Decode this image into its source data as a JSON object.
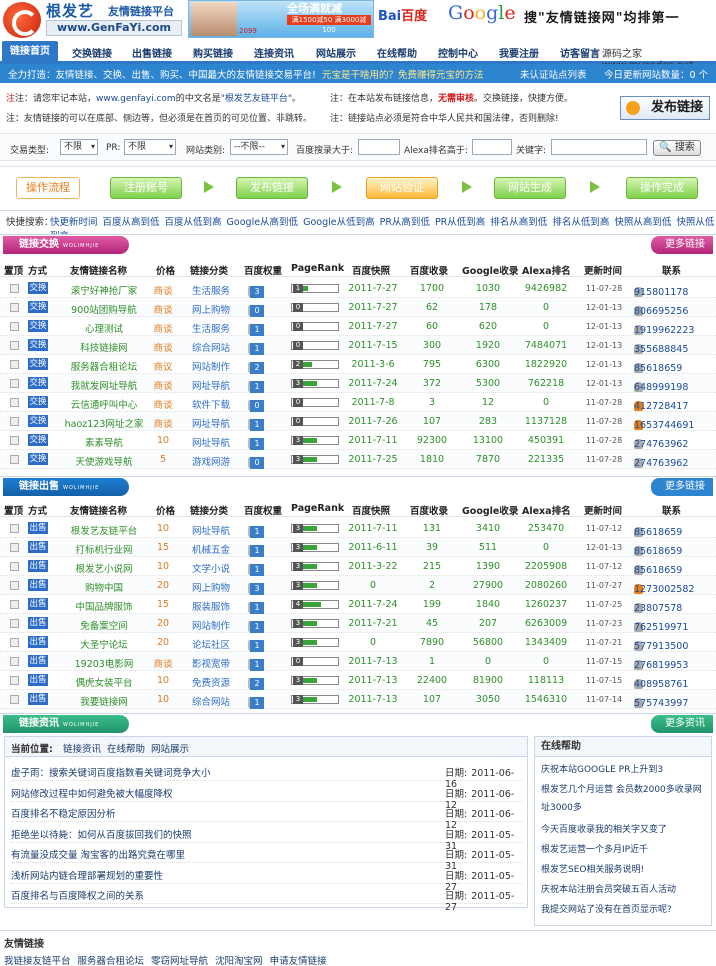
{
  "header": {
    "logo_text": "根发艺",
    "logo_sub": "友情链接平台",
    "logo_url": "www.GenFaYi.com",
    "ad_title": "全场满就减",
    "ad_line": "满1500减50  满3000减100",
    "ad_line2": "2099",
    "baidu": "Bai",
    "baidu_cn": "百度",
    "google": "Google",
    "slogan": "搜\"友情链接网\"均排第一"
  },
  "nav": {
    "items": [
      "链接首页",
      "交换链接",
      "出售链接",
      "购买链接",
      "连接资讯",
      "网站展示",
      "在线帮助",
      "控制中心",
      "我要注册",
      "访客留言"
    ],
    "right": "源码之家www.mycodes.net"
  },
  "subbar": {
    "left": "全力打造：友情链接、交换、出售、购买、中国最大的友情链接交易平台!",
    "highlight": "元宝是干啥用的？免费赚得元宝的方法",
    "middle": "未认证站点列表",
    "right": "今日更新网站数量：0 个"
  },
  "notice": {
    "l1_pre": "注：请您牢记本站，",
    "l1_url": "www.genfayi.com",
    "l1_mid": "的中文名是",
    "l1_name": "\"根发艺友链平台\"",
    "l1_end": "。",
    "l2": "注：友情链接的可以在底部、侧边等，但必须是在首页的可见位置、非跳转。",
    "r1_pre": "注：在本站发布链接信息，",
    "r1_red": "无需审核",
    "r1_end": "。交换链接，快捷方便。",
    "r2": "注：链接站点必须是符合中华人民共和国法律，否则删除!",
    "publish": "发布链接"
  },
  "search": {
    "type_label": "交易类型:",
    "type_value": "不限",
    "pr_label": "PR:",
    "pr_value": "不限",
    "cat_label": "网站类别:",
    "cat_value": "--不限--",
    "baidu_label": "百度搜录大于:",
    "alexa_label": "Alexa排名高于:",
    "kw_label": "关键字:",
    "button": "搜索"
  },
  "process": {
    "steps": [
      "操作流程",
      "注册账号",
      "发布链接",
      "网站验证",
      "网站生成",
      "操作完成"
    ]
  },
  "quick": {
    "label": "快捷搜索：",
    "items": "快更新时间 百度从高到低 百度从低到高 Google从高到低 Google从低到高 PR从高到低 PR从低到高 排名从高到低 排名从低到高 快照从高到低 快照从低到高"
  },
  "columns": [
    "置顶",
    "方式",
    "友情链接名称",
    "价格",
    "链接分类",
    "百度权重",
    "PageRank",
    "百度快照",
    "百度收录",
    "Google收录",
    "Alexa排名",
    "更新时间",
    "联系"
  ],
  "exchange": {
    "title": "链接交换",
    "sub": "WOLIMHJIE",
    "more": "更多链接",
    "rows": [
      {
        "mode": "交换",
        "name": "滚宁好神抢厂家",
        "price": "商谈",
        "cat": "生活服务",
        "bd": "3",
        "pr": "1",
        "prw": 0.1,
        "date": "2011-7-27",
        "bin": "1700",
        "gin": "1030",
        "alexa": "9426982",
        "upd": "11-07-28",
        "contact": "915801178",
        "qq": false
      },
      {
        "mode": "交换",
        "name": "900站团购导航",
        "price": "商谈",
        "cat": "网上购物",
        "bd": "0",
        "pr": "0",
        "prw": 0.0,
        "date": "2011-7-27",
        "bin": "62",
        "gin": "178",
        "alexa": "0",
        "upd": "12-01-13",
        "contact": "806695256",
        "qq": false
      },
      {
        "mode": "交换",
        "name": "心理测试",
        "price": "商谈",
        "cat": "生活服务",
        "bd": "1",
        "pr": "0",
        "prw": 0.0,
        "date": "2011-7-27",
        "bin": "60",
        "gin": "620",
        "alexa": "0",
        "upd": "12-01-13",
        "contact": "1919962223",
        "qq": false
      },
      {
        "mode": "交换",
        "name": "科技链接网",
        "price": "商谈",
        "cat": "综合网站",
        "bd": "1",
        "pr": "0",
        "prw": 0.0,
        "date": "2011-7-15",
        "bin": "300",
        "gin": "1920",
        "alexa": "7484071",
        "upd": "12-01-13",
        "contact": "355688845",
        "qq": false
      },
      {
        "mode": "交换",
        "name": "服务器合租论坛",
        "price": "商议",
        "cat": "网站制作",
        "bd": "2",
        "pr": "2",
        "prw": 0.2,
        "date": "2011-3-6",
        "bin": "795",
        "gin": "6300",
        "alexa": "1822920",
        "upd": "12-01-13",
        "contact": "85618659",
        "qq": false
      },
      {
        "mode": "交换",
        "name": "我就发网址导航",
        "price": "商谈",
        "cat": "网址导航",
        "bd": "1",
        "pr": "3",
        "prw": 0.3,
        "date": "2011-7-24",
        "bin": "372",
        "gin": "5300",
        "alexa": "762218",
        "upd": "12-01-13",
        "contact": "648999198",
        "qq": false
      },
      {
        "mode": "交换",
        "name": "云信通呼叫中心",
        "price": "商谈",
        "cat": "软件下载",
        "bd": "0",
        "pr": "0",
        "prw": 0.0,
        "date": "2011-7-8",
        "bin": "3",
        "gin": "12",
        "alexa": "0",
        "upd": "11-07-28",
        "contact": "412728417",
        "qq": true
      },
      {
        "mode": "交换",
        "name": "haoz123网址之家",
        "price": "商谈",
        "cat": "网址导航",
        "bd": "1",
        "pr": "0",
        "prw": 0.0,
        "date": "2011-7-26",
        "bin": "107",
        "gin": "283",
        "alexa": "1137128",
        "upd": "11-07-28",
        "contact": "1653744691",
        "qq": true
      },
      {
        "mode": "交换",
        "name": "素素导航",
        "price": "10",
        "cat": "网址导航",
        "bd": "1",
        "pr": "3",
        "prw": 0.3,
        "date": "2011-7-11",
        "bin": "92300",
        "gin": "13100",
        "alexa": "450391",
        "upd": "11-07-28",
        "contact": "274763962",
        "qq": false
      },
      {
        "mode": "交换",
        "name": "天使游戏导航",
        "price": "5",
        "cat": "游戏网游",
        "bd": "0",
        "pr": "3",
        "prw": 0.3,
        "date": "2011-7-25",
        "bin": "1810",
        "gin": "7870",
        "alexa": "221335",
        "upd": "11-07-28",
        "contact": "274763962",
        "qq": false
      }
    ]
  },
  "sale": {
    "title": "链接出售",
    "sub": "WOLIMHJIE",
    "more": "更多链接",
    "rows": [
      {
        "mode": "出售",
        "name": "根发艺友链平台",
        "price": "10",
        "cat": "网址导航",
        "bd": "1",
        "pr": "3",
        "prw": 0.3,
        "date": "2011-7-11",
        "bin": "131",
        "gin": "3410",
        "alexa": "253470",
        "upd": "11-07-12",
        "contact": "85618659",
        "qq": false
      },
      {
        "mode": "出售",
        "name": "打标机行业网",
        "price": "15",
        "cat": "机械五金",
        "bd": "1",
        "pr": "3",
        "prw": 0.3,
        "date": "2011-6-11",
        "bin": "39",
        "gin": "511",
        "alexa": "0",
        "upd": "12-01-13",
        "contact": "85618659",
        "qq": false
      },
      {
        "mode": "出售",
        "name": "根发艺小说网",
        "price": "10",
        "cat": "文学小说",
        "bd": "1",
        "pr": "3",
        "prw": 0.3,
        "date": "2011-3-22",
        "bin": "215",
        "gin": "1390",
        "alexa": "2205908",
        "upd": "11-07-12",
        "contact": "85618659",
        "qq": false
      },
      {
        "mode": "出售",
        "name": "购物中国",
        "price": "20",
        "cat": "网上购物",
        "bd": "3",
        "pr": "3",
        "prw": 0.3,
        "date": "0",
        "bin": "2",
        "gin": "27900",
        "alexa": "2080260",
        "upd": "11-07-27",
        "contact": "1273002582",
        "qq": true
      },
      {
        "mode": "出售",
        "name": "中国品牌服饰",
        "price": "15",
        "cat": "服装服饰",
        "bd": "1",
        "pr": "4",
        "prw": 0.4,
        "date": "2011-7-24",
        "bin": "199",
        "gin": "1840",
        "alexa": "1260237",
        "upd": "11-07-25",
        "contact": "23807578",
        "qq": false
      },
      {
        "mode": "出售",
        "name": "免备案空间",
        "price": "20",
        "cat": "网站制作",
        "bd": "1",
        "pr": "3",
        "prw": 0.3,
        "date": "2011-7-21",
        "bin": "45",
        "gin": "207",
        "alexa": "6263009",
        "upd": "11-07-23",
        "contact": "762519971",
        "qq": false
      },
      {
        "mode": "出售",
        "name": "大圣宁论坛",
        "price": "20",
        "cat": "论坛社区",
        "bd": "1",
        "pr": "3",
        "prw": 0.3,
        "date": "0",
        "bin": "7890",
        "gin": "56800",
        "alexa": "1343409",
        "upd": "11-07-21",
        "contact": "577913500",
        "qq": false
      },
      {
        "mode": "出售",
        "name": "19203电影网",
        "price": "商谈",
        "cat": "影视宽带",
        "bd": "1",
        "pr": "0",
        "prw": 0.0,
        "date": "2011-7-13",
        "bin": "1",
        "gin": "0",
        "alexa": "0",
        "upd": "11-07-15",
        "contact": "276819953",
        "qq": false
      },
      {
        "mode": "出售",
        "name": "偶虎女装平台",
        "price": "10",
        "cat": "免费资源",
        "bd": "2",
        "pr": "3",
        "prw": 0.3,
        "date": "2011-7-13",
        "bin": "22400",
        "gin": "81900",
        "alexa": "118113",
        "upd": "11-07-15",
        "contact": "408958761",
        "qq": false
      },
      {
        "mode": "出售",
        "name": "我要链接网",
        "price": "10",
        "cat": "综合网站",
        "bd": "1",
        "pr": "3",
        "prw": 0.3,
        "date": "2011-7-13",
        "bin": "107",
        "gin": "3050",
        "alexa": "1546310",
        "upd": "11-07-14",
        "contact": "575743997",
        "qq": false
      }
    ]
  },
  "info": {
    "title": "链接资讯",
    "sub": "WOLIMHJIE",
    "more": "更多资讯",
    "crumb_label": "当前位置:",
    "crumbs": [
      "链接资讯",
      "在线帮助",
      "网站展示"
    ],
    "date_label": "日期:",
    "news": [
      {
        "title": "虚子雨：搜索关键词百度指数看关键词竞争大小",
        "date": "2011-06-16"
      },
      {
        "title": "网站修改过程中如何避免被大幅度降权",
        "date": "2011-06-12"
      },
      {
        "title": "百度排名不稳定原因分析",
        "date": "2011-06-12"
      },
      {
        "title": "拒绝坐以待毙：如何从百度拔回我们的快照",
        "date": "2011-05-31"
      },
      {
        "title": "有流量没成交量 淘宝客的出路究竟在哪里",
        "date": "2011-05-31"
      },
      {
        "title": "浅析网站内链合理部署规划的重要性",
        "date": "2011-05-27"
      },
      {
        "title": "百度排名与百度降权之间的关系",
        "date": "2011-05-27"
      }
    ]
  },
  "help": {
    "title": "在线帮助",
    "items": [
      "庆祝本站GOOGLE PR上升到3",
      "根发艺几个月运营 会员数2000多收录网址3000多",
      "今天百度收录我的相关字又变了",
      "根发艺运营一个多月IP近千",
      "根发艺SEO相关服务说明!",
      "庆祝本站注册会员突破五百人活动",
      "我提交网站了没有在首页显示呢?"
    ]
  },
  "friends": {
    "title": "友情链接",
    "items": "我链接友链平台  服务器合租论坛  零窃网址导航  沈阳淘宝网  申请友情链接"
  }
}
